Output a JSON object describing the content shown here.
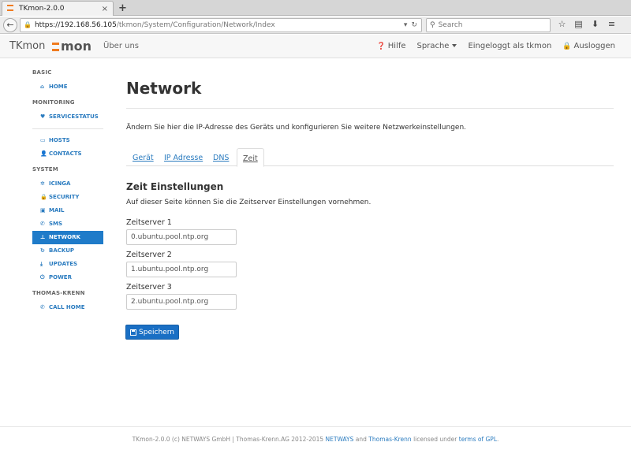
{
  "browser": {
    "tab_title": "TKmon-2.0.0",
    "tab_close": "×",
    "new_tab": "+",
    "url_host": "https://192.168.56.105",
    "url_path": "/tkmon/System/Configuration/Network/Index",
    "search_placeholder": "Search"
  },
  "header": {
    "brand": "TKmon",
    "logo_text": "mon",
    "about": "Über uns",
    "help": "Hilfe",
    "language": "Sprache",
    "logged_in": "Eingeloggt als tkmon",
    "logout": "Ausloggen"
  },
  "sidebar": {
    "basic_label": "BASIC",
    "home": "HOME",
    "monitoring_label": "MONITORING",
    "servicestatus": "SERVICESTATUS",
    "hosts": "HOSTS",
    "contacts": "CONTACTS",
    "system_label": "SYSTEM",
    "icinga": "ICINGA",
    "security": "SECURITY",
    "mail": "MAIL",
    "sms": "SMS",
    "network": "NETWORK",
    "backup": "BACKUP",
    "updates": "UPDATES",
    "power": "POWER",
    "tk_label": "THOMAS-KRENN",
    "call_home": "CALL HOME"
  },
  "main": {
    "title": "Network",
    "intro": "Ändern Sie hier die IP-Adresse des Geräts und konfigurieren Sie weitere Netzwerkeinstellungen.",
    "tabs": [
      "Gerät",
      "IP Adresse",
      "DNS",
      "Zeit"
    ],
    "section_title": "Zeit Einstellungen",
    "section_desc": "Auf dieser Seite können Sie die Zeitserver Einstellungen vornehmen.",
    "fields": [
      {
        "label": "Zeitserver 1",
        "value": "0.ubuntu.pool.ntp.org"
      },
      {
        "label": "Zeitserver 2",
        "value": "1.ubuntu.pool.ntp.org"
      },
      {
        "label": "Zeitserver 3",
        "value": "2.ubuntu.pool.ntp.org"
      }
    ],
    "save": "Speichern"
  },
  "footer": {
    "prefix": "TKmon-2.0.0 (c) NETWAYS GmbH | Thomas-Krenn.AG 2012-2015",
    "netways": "NETWAYS",
    "and": "and",
    "tk": "Thomas-Krenn",
    "licensed": "licensed under",
    "gpl": "terms of GPL",
    "end": "."
  },
  "colors": {
    "accent": "#1f7bc9",
    "link": "#2a7bbf",
    "logo": "#f07b1f"
  }
}
